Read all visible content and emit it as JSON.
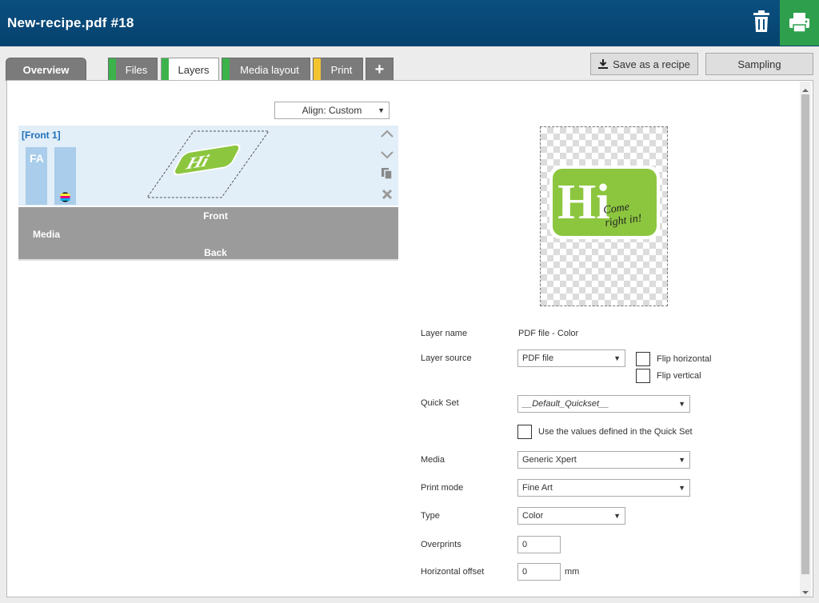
{
  "window": {
    "title": "New-recipe.pdf #18"
  },
  "header_icons": {
    "delete": "trash-icon",
    "print": "printer-icon"
  },
  "tabs": [
    {
      "label": "Overview",
      "color": ""
    },
    {
      "label": "Files",
      "color": "#3bb34a"
    },
    {
      "label": "Layers",
      "color": "#3bb34a"
    },
    {
      "label": "Media layout",
      "color": "#3bb34a"
    },
    {
      "label": "Print",
      "color": "#f4c430"
    },
    {
      "label": "+",
      "color": ""
    }
  ],
  "actions": {
    "save_recipe": "Save as a recipe",
    "sampling": "Sampling"
  },
  "align": {
    "value": "Align: Custom"
  },
  "layers": {
    "front_label": "[Front 1]",
    "fa_label": "FA",
    "media_front": "Front",
    "media_label": "Media",
    "media_back": "Back"
  },
  "preview": {
    "logo_big": "Hi",
    "logo_small_1": "Come",
    "logo_small_2": "right in!"
  },
  "form": {
    "layer_name_label": "Layer name",
    "layer_name_value": "PDF file - Color",
    "layer_source_label": "Layer source",
    "layer_source_value": "PDF file",
    "flip_horizontal": "Flip horizontal",
    "flip_vertical": "Flip vertical",
    "quick_set_label": "Quick Set",
    "quick_set_value": "__Default_Quickset__",
    "use_quickset": "Use the values defined in the Quick Set",
    "media_label": "Media",
    "media_value": "Generic Xpert",
    "print_mode_label": "Print mode",
    "print_mode_value": "Fine Art",
    "type_label": "Type",
    "type_value": "Color",
    "overprints_label": "Overprints",
    "overprints_value": "0",
    "horizontal_offset_label": "Horizontal offset",
    "horizontal_offset_value": "0",
    "horizontal_offset_unit": "mm"
  },
  "colors": {
    "header": "#06426e",
    "print_button": "#2ea04d",
    "accent_link": "#1f6fb8",
    "logo_green": "#8cc63f"
  }
}
